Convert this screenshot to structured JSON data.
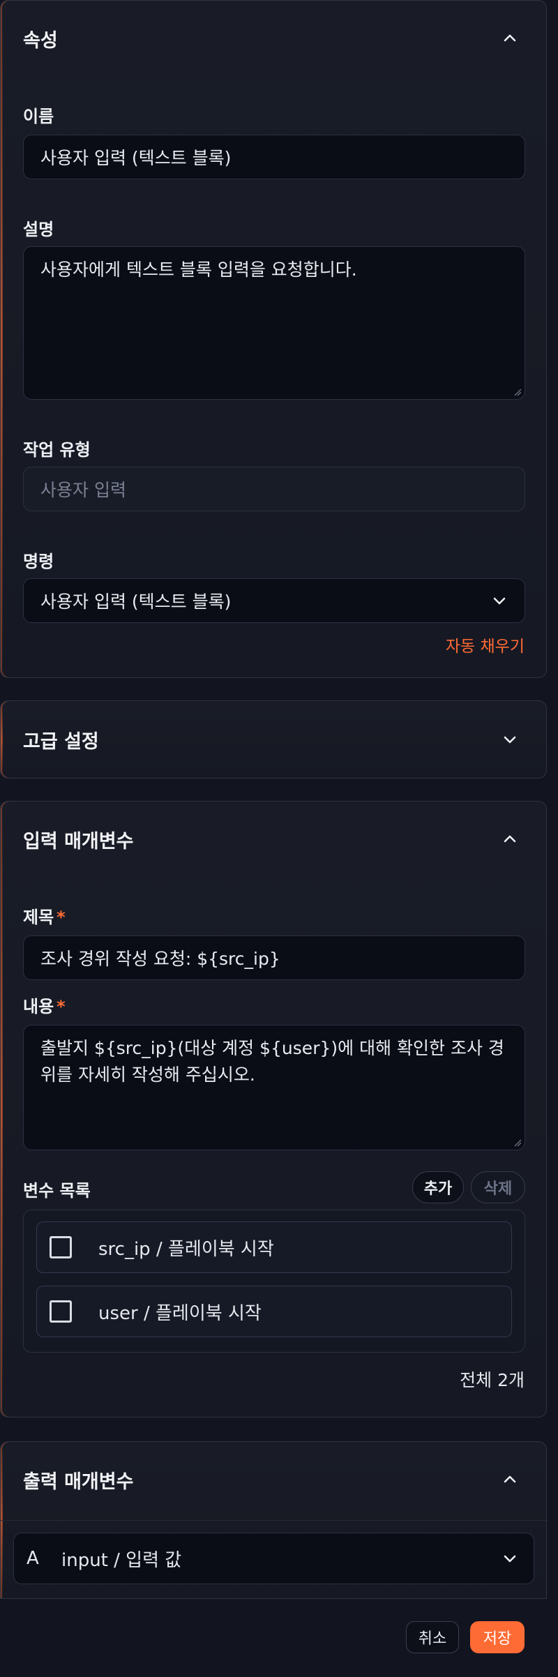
{
  "properties": {
    "title": "속성",
    "name_label": "이름",
    "name_value": "사용자 입력 (텍스트 블록)",
    "description_label": "설명",
    "description_value": "사용자에게 텍스트 블록 입력을 요청합니다.",
    "task_type_label": "작업 유형",
    "task_type_placeholder": "사용자 입력",
    "command_label": "명령",
    "command_value": "사용자 입력 (텍스트 블록)",
    "autofill_label": "자동 채우기"
  },
  "advanced": {
    "title": "고급 설정"
  },
  "input_params": {
    "title": "입력 매개변수",
    "subject_label": "제목",
    "subject_value": "조사 경위 작성 요청: ${src_ip}",
    "content_label": "내용",
    "content_value": "출발지 ${src_ip}(대상 계정 ${user})에 대해 확인한 조사 경위를 자세히 작성해 주십시오.",
    "required_mark": "*",
    "variables_label": "변수 목록",
    "add_label": "추가",
    "delete_label": "삭제",
    "variables": [
      {
        "label": "src_ip / 플레이북 시작",
        "checked": false
      },
      {
        "label": "user / 플레이북 시작",
        "checked": false
      }
    ],
    "total_label": "전체 2개"
  },
  "output_params": {
    "title": "출력 매개변수",
    "type_badge": "A",
    "output_value": "input / 입력 값"
  },
  "footer": {
    "cancel_label": "취소",
    "save_label": "저장"
  },
  "colors": {
    "accent": "#ff6b35",
    "background": "#121520",
    "panel": "#181b25",
    "field": "#0a0d16"
  }
}
